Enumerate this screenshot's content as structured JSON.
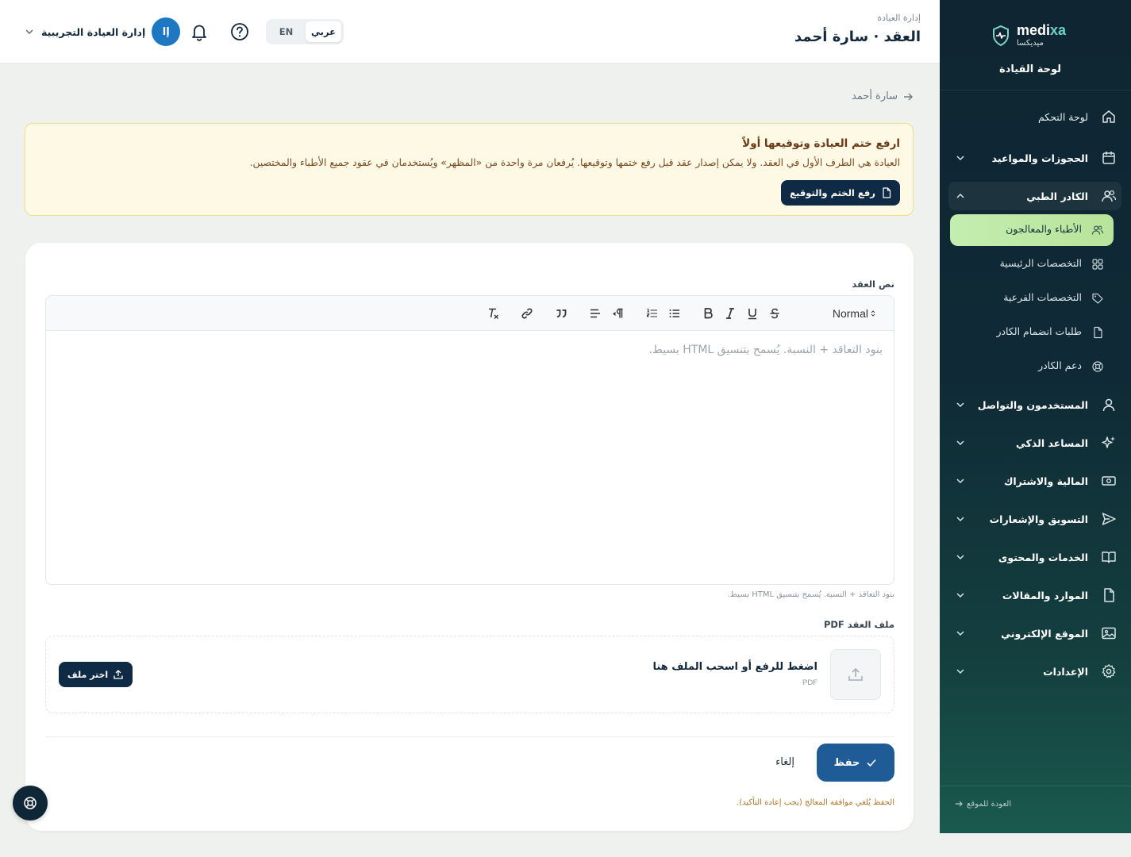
{
  "brand": {
    "name_en_part1": "medi",
    "name_en_part2": "xa",
    "name_ar": "ميديكسا",
    "title": "لوحة القيادة"
  },
  "colors": {
    "sidebar_bg": "#0f2532",
    "active_item": "#c4edb0",
    "primary": "#1f5b96",
    "dark_button": "#0e2a45",
    "alert_bg": "#fdf9e4"
  },
  "nav": {
    "dashboard": "لوحة التحكم",
    "bookings": "الحجوزات والمواعيد",
    "staff": "الكادر الطبي",
    "staff_sub": {
      "doctors": "الأطباء والمعالجون",
      "main_specialties": "التخصصات الرئيسية",
      "sub_specialties": "التخصصات الفرعية",
      "join_requests": "طلبات انضمام الكادر",
      "staff_support": "دعم الكادر"
    },
    "users": "المستخدمون والتواصل",
    "ai": "المساعد الذكي",
    "finance": "المالية والاشتراك",
    "marketing": "التسويق والإشعارات",
    "services": "الخدمات والمحتوى",
    "resources": "الموارد والمقالات",
    "website": "الموقع الإلكتروني",
    "settings": "الإعدادات",
    "back_to_site": "العودة للموقع"
  },
  "header": {
    "crumb": "إدارة العيادة",
    "title": "العقد · سارة أحمد",
    "lang_ar": "عربي",
    "lang_en": "EN",
    "user_initials": "إا",
    "user_name": "إدارة العيادة التجريبية"
  },
  "back_crumb": "سارة أحمد",
  "alert": {
    "title": "ارفع ختم العيادة وتوقيعها أولاً",
    "text": "العيادة هي الطرف الأول في العقد. ولا يمكن إصدار عقد قبل رفع ختمها وتوقيعها. يُرفعان مرة واحدة من «المظهر» ويُستخدمان في عقود جميع الأطباء والمختصين.",
    "button": "رفع الختم والتوقيع"
  },
  "form": {
    "contract_text_label": "نص العقد",
    "toolbar_normal": "Normal",
    "editor_placeholder": "بنود التعاقد + النسبة. يُسمح بتنسيق HTML بسيط.",
    "helper": "بنود التعاقد + النسبة. يُسمح بتنسيق HTML بسيط.",
    "pdf_label": "ملف العقد PDF",
    "dropzone_title": "اضغط للرفع أو اسحب الملف هنا",
    "dropzone_sub": "PDF",
    "choose_file": "اختر ملف",
    "save": "حفظ",
    "cancel": "إلغاء",
    "save_note": "الحفظ يُلغي موافقة المعالج (يجب إعادة التأكيد)."
  }
}
